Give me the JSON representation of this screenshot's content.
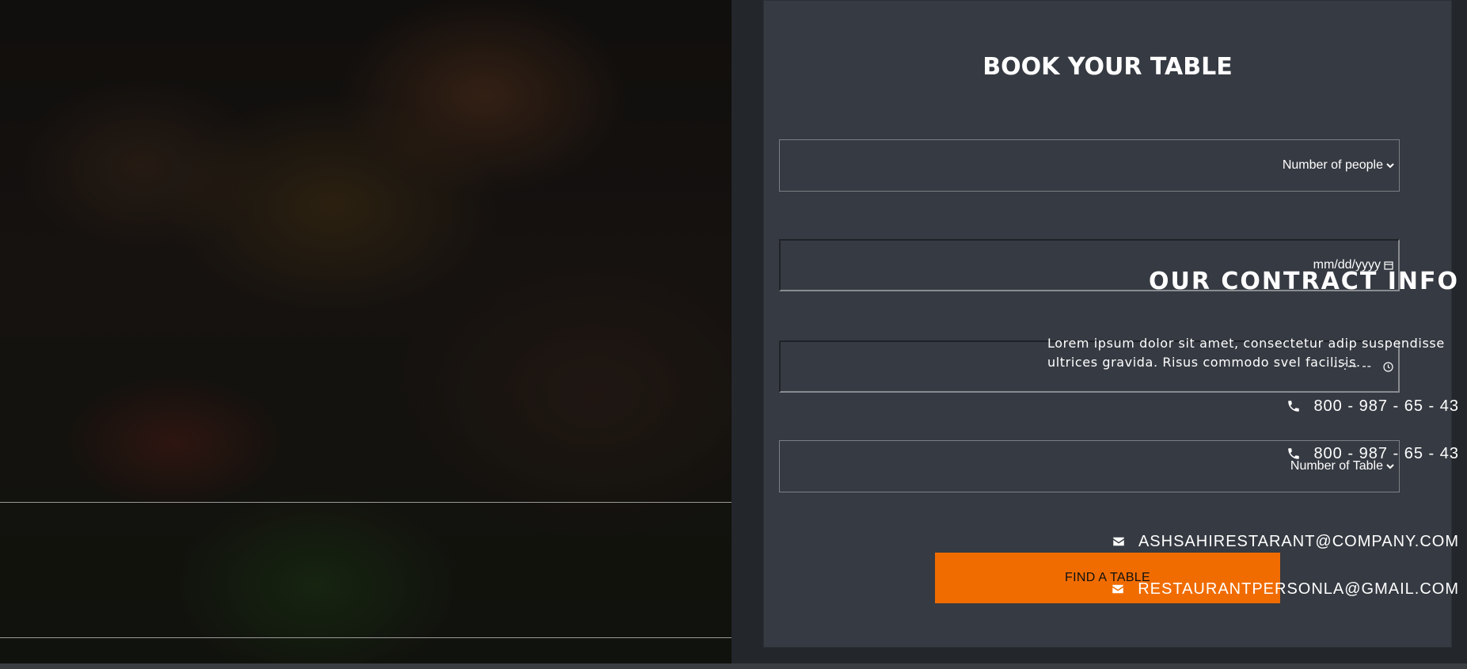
{
  "contact": {
    "title": "OUR CONTRACT INFO",
    "description": "Lorem ipsum dolor sit amet, consectetur adip suspendisse ultrices gravida. Risus commodo svel facilisis.",
    "phones": [
      "800 - 987 - 65 - 43",
      "800 - 987 - 65 - 43"
    ],
    "emails": [
      "ASHSAHIRESTARANT@COMPANY.COM",
      "RESTAURANTPERSONLA@GMAIL.COM"
    ],
    "icons": {
      "phone": "phone-icon",
      "email": "envelope-icon"
    }
  },
  "booking": {
    "title": "BOOK YOUR TABLE",
    "people_select": "Number of people",
    "date_placeholder": "mm/dd/yyyy",
    "time_placeholder": "--:-- --",
    "table_select": "Number of Table",
    "submit_label": "FIND A TABLE"
  },
  "colors": {
    "accent": "#f06c00",
    "panel": "#363a42",
    "background": "#23262b"
  }
}
